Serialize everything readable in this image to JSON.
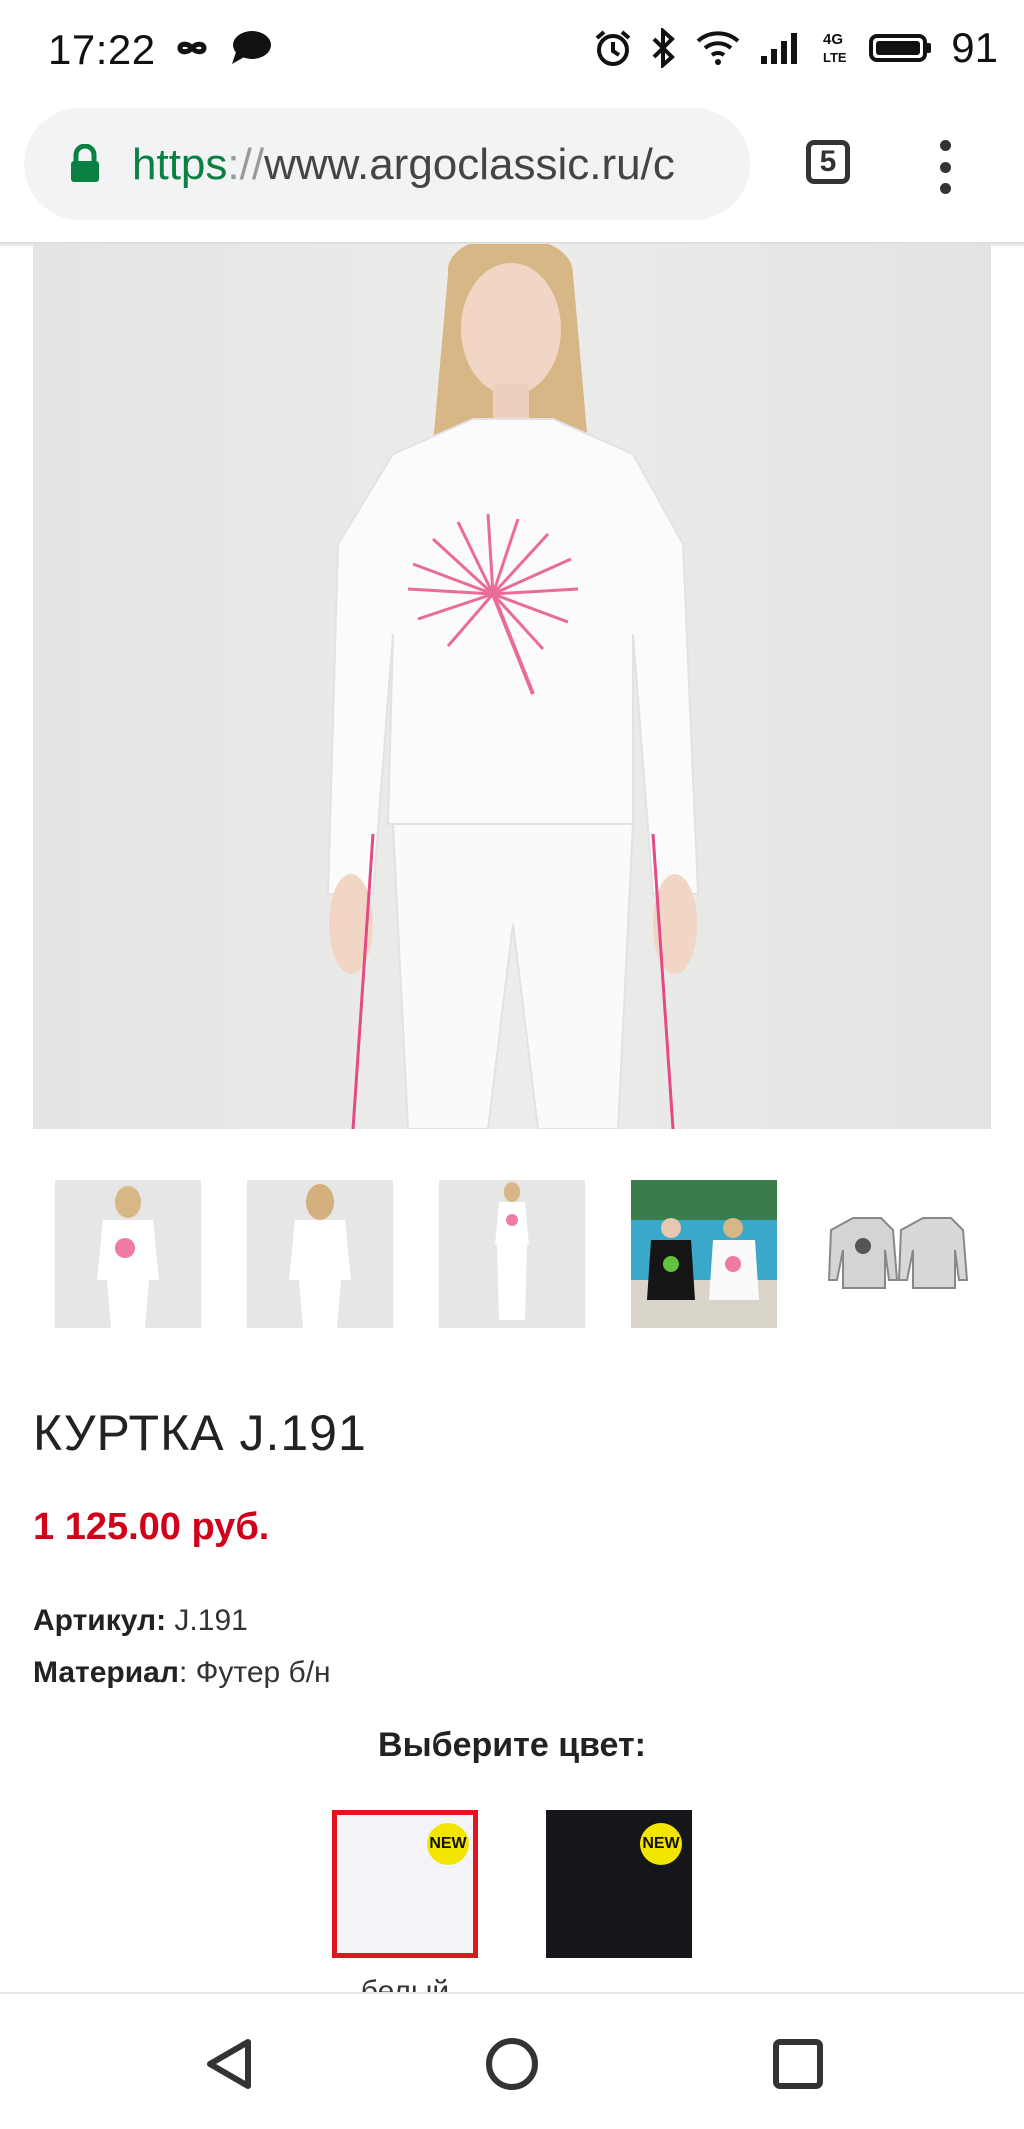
{
  "status_bar": {
    "time": "17:22",
    "battery": "91",
    "icons": [
      "infinity-icon",
      "chat-bubble-icon",
      "alarm-icon",
      "bluetooth-icon",
      "wifi-icon",
      "signal-icon",
      "lte-icon",
      "battery-icon"
    ]
  },
  "browser": {
    "url_scheme": "https",
    "url_sep": "://",
    "url_rest": "www.argoclassic.ru/c",
    "tab_count": "5"
  },
  "product": {
    "title": "КУРТКА J.191",
    "price": "1 125.00 руб.",
    "article_label": "Артикул:",
    "article_value": " J.191",
    "material_label": "Материал",
    "material_value": ": Футер б/н",
    "choose_color": "Выберите цвет:",
    "thumbnails": [
      "front-view",
      "back-view",
      "full-length",
      "lifestyle-photo",
      "technical-sketch"
    ],
    "colors": [
      {
        "name": "белый",
        "badge": "NEW",
        "swatch": "#f3f3fa",
        "selected": true
      },
      {
        "name": "",
        "badge": "NEW",
        "swatch": "#15161a",
        "selected": false
      }
    ]
  },
  "colors": {
    "accent_red": "#d0021b",
    "https_green": "#0b8043",
    "badge_yellow": "#f2e600"
  }
}
